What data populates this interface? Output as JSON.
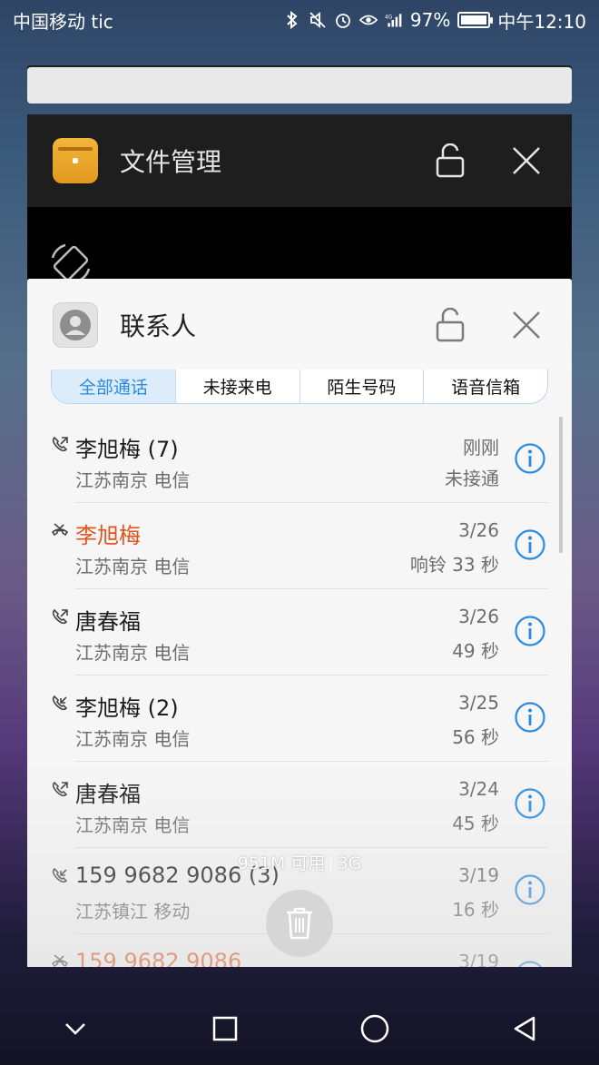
{
  "status_bar": {
    "carrier": "中国移动 tic",
    "battery_percent": "97%",
    "battery_level": 0.97,
    "time": "中午12:10",
    "network": "4G"
  },
  "recent_cards": {
    "files_app": {
      "title": "文件管理",
      "icon": "folder-icon"
    },
    "contacts_app": {
      "title": "联系人",
      "icon": "contacts-icon"
    }
  },
  "tabs": [
    "全部通话",
    "未接来电",
    "陌生号码",
    "语音信箱"
  ],
  "calls": [
    {
      "name": "李旭梅 (7)",
      "location": "江苏南京 电信",
      "time": "刚刚",
      "detail": "未接通",
      "type": "outgoing",
      "missed": false
    },
    {
      "name": "李旭梅",
      "location": "江苏南京 电信",
      "time": "3/26",
      "detail": "响铃 33 秒",
      "type": "missed",
      "missed": true
    },
    {
      "name": "唐春福",
      "location": "江苏南京 电信",
      "time": "3/26",
      "detail": "49 秒",
      "type": "outgoing",
      "missed": false
    },
    {
      "name": "李旭梅 (2)",
      "location": "江苏南京 电信",
      "time": "3/25",
      "detail": "56 秒",
      "type": "incoming",
      "missed": false
    },
    {
      "name": "唐春福",
      "location": "江苏南京 电信",
      "time": "3/24",
      "detail": "45 秒",
      "type": "outgoing",
      "missed": false
    },
    {
      "name": "159 9682 9086 (3)",
      "location": "江苏镇江 移动",
      "time": "3/19",
      "detail": "16 秒",
      "type": "incoming",
      "missed": false
    },
    {
      "name": "159 9682 9086",
      "location": "",
      "time": "3/19",
      "detail": "",
      "type": "missed",
      "missed": true
    }
  ],
  "memory": {
    "available": "951M 可用",
    "network": "3G"
  },
  "colors": {
    "accent": "#2a8be0",
    "missed": "#e2531f"
  }
}
